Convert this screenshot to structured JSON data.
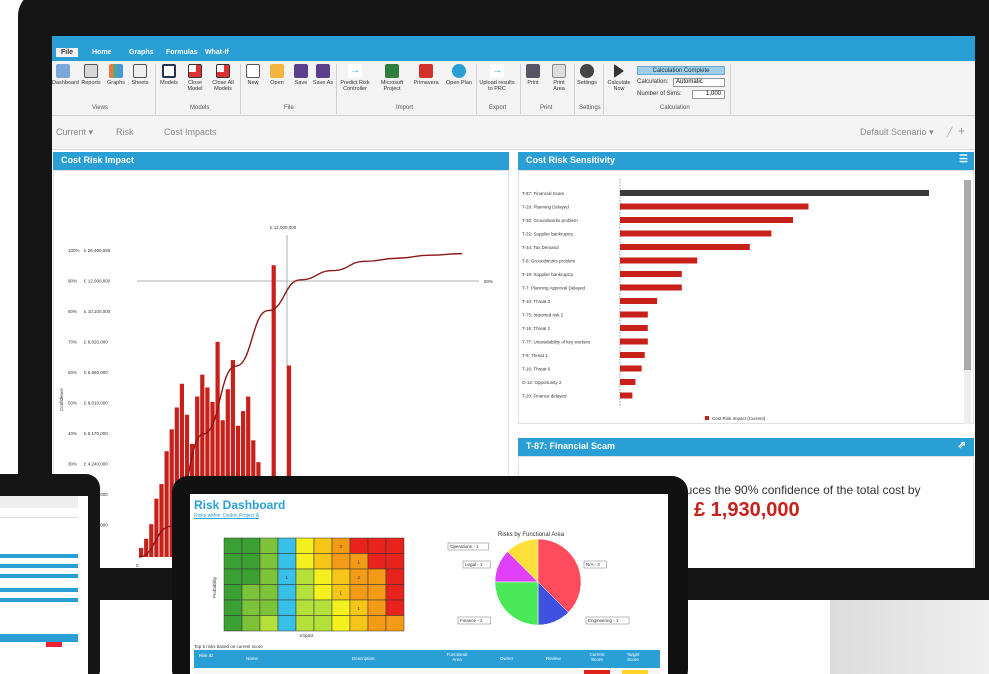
{
  "ribbon": {
    "tabs": [
      "File",
      "Home",
      "Graphs",
      "Formulas",
      "What-If"
    ],
    "buttons": [
      "Dashboard",
      "Reports",
      "Graphs",
      "Sheets",
      "Models",
      "Close Model",
      "Close All Models",
      "New",
      "Open",
      "Save",
      "Save As",
      "Predict Risk Controller",
      "Microsoft Project",
      "Primavera",
      "Open Plan",
      "Upload results to PRC",
      "Print",
      "Print Area",
      "Settings",
      "Calculate Now"
    ],
    "groups": [
      "Views",
      "Models",
      "File",
      "Import",
      "Export",
      "Print",
      "Settings",
      "Calculation"
    ],
    "calc_status": "Calculation Complete",
    "calc_label": "Calculation:",
    "calc_value": "Automatic",
    "sims_label": "Number of Sims:",
    "sims_value": "1,000"
  },
  "subnav": {
    "current": "Current",
    "risk": "Risk",
    "cost_impacts": "Cost Impacts",
    "scenario": "Default Scenario"
  },
  "cost_risk_impact": {
    "title": "Cost Risk Impact",
    "top_label": "£ 12,000,000",
    "ref_label": "90%",
    "ylabel": "Confidence",
    "left_ticks": [
      {
        "pct": "100%",
        "val": "£ 26,400,555"
      },
      {
        "pct": "90%",
        "val": "£ 12,000,000"
      },
      {
        "pct": "80%",
        "val": "£ 10,100,000"
      },
      {
        "pct": "70%",
        "val": "£ 8,820,000"
      },
      {
        "pct": "60%",
        "val": "£ 6,960,000"
      },
      {
        "pct": "50%",
        "val": "£ 6,010,000"
      },
      {
        "pct": "40%",
        "val": "£ 5,170,000"
      },
      {
        "pct": "30%",
        "val": "£ 4,240,000"
      },
      {
        "pct": "20%",
        "val": "£ 3,400,000"
      },
      {
        "pct": "10%",
        "val": "£ 2,250,000"
      },
      {
        "pct": "",
        "val": "£ 0"
      }
    ],
    "x_zero": "0"
  },
  "chart_data": [
    {
      "type": "bar",
      "title": "Cost Risk Impact",
      "ylabel": "Confidence",
      "values": [
        5,
        10,
        18,
        32,
        40,
        58,
        70,
        82,
        95,
        78,
        62,
        88,
        100,
        93,
        85,
        118,
        75,
        92,
        108,
        72,
        80,
        88,
        64,
        52,
        38,
        30,
        160,
        20,
        18,
        105,
        15,
        12,
        8,
        20,
        8,
        6,
        3,
        3,
        2,
        2,
        1,
        8,
        3,
        2
      ],
      "ylim": [
        0,
        170
      ]
    },
    {
      "type": "line",
      "title": "Cost Risk Impact",
      "ylabel": "Confidence",
      "x": [
        0,
        10,
        20,
        30,
        40,
        50,
        60,
        70,
        80,
        90,
        100
      ],
      "values": [
        0,
        10,
        40,
        62,
        80,
        90,
        93,
        96,
        97,
        98,
        98.5
      ],
      "ylim": [
        0,
        100
      ]
    },
    {
      "type": "bar",
      "title": "Cost Risk Sensitivity",
      "categories": [
        "T-87: Financial Scam",
        "T-29: Planning Delayed",
        "T-30: Groundworks problem",
        "T-32: Supplier bankruptcy",
        "T-34: Tax Demand",
        "T-8: Groundworks problem",
        "T-18: Supplier bankruptcy",
        "T-7: Planning Approval Delayed",
        "T-10: Threat 3",
        "T-75: Imported risk 2",
        "T-16: Threat 2",
        "T-77: Unavailability of key workers",
        "T-9: Threat 1",
        "T-16: Threat 6",
        "O-12: Opportunity 2",
        "T-20: Finance delayed"
      ],
      "values": [
        100,
        61,
        56,
        49,
        42,
        25,
        20,
        20,
        12,
        9,
        9,
        9,
        8,
        7,
        5,
        4
      ],
      "legend": [
        "Cost Risk Impact (Current)"
      ]
    },
    {
      "type": "heatmap",
      "title": "Risk Dashboard",
      "xlabel": "Impact",
      "ylabel": "Probability",
      "cell_labels": [
        {
          "row": 0,
          "col": 6,
          "text": "3"
        },
        {
          "row": 2,
          "col": 3,
          "text": "1"
        },
        {
          "row": 2,
          "col": 7,
          "text": "2"
        },
        {
          "row": 3,
          "col": 6,
          "text": "1"
        },
        {
          "row": 1,
          "col": 7,
          "text": "1"
        },
        {
          "row": 4,
          "col": 7,
          "text": "1"
        }
      ]
    },
    {
      "type": "pie",
      "title": "Risks by Functional Area",
      "categories": [
        "Operations - 1",
        "Legal - 1",
        "N/A - 3",
        "Engineering - 1",
        "Finance - 2"
      ],
      "values": [
        1,
        1,
        3,
        1,
        2
      ]
    }
  ],
  "sensitivity": {
    "title": "Cost Risk Sensitivity",
    "legend": "Cost Risk Impact (Current)"
  },
  "scam_panel": {
    "title": "T-87: Financial Scam",
    "text": "duces the 90% confidence of the total cost by",
    "amount": "£ 1,930,000"
  },
  "laptop": {
    "title": "Risk Dashboard",
    "subtitle": "Risks within: Dalton Project A",
    "pie_title": "Risks by Functional Area",
    "impact_label": "Impact",
    "prob_label": "Probability",
    "table_caption": "Top 5 risks based on current score",
    "columns": [
      "Risk ID",
      "Name",
      "Description",
      "Functional Area",
      "Owner",
      "Review",
      "Current Score",
      "Target Score"
    ]
  },
  "colors": {
    "accent": "#2a9fd6",
    "bar": "#c8211b",
    "highlight_bar": "#3a3a3a"
  }
}
